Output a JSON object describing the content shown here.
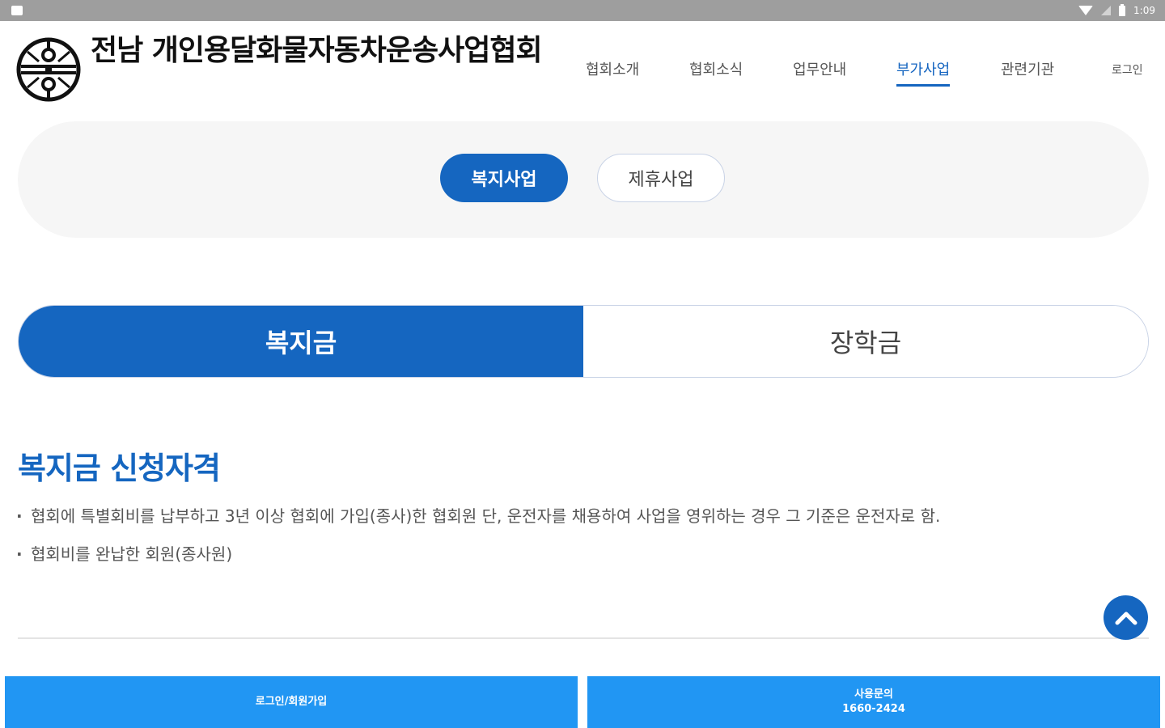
{
  "status_bar": {
    "time": "1:09",
    "icons": [
      "notification-icon",
      "wifi-icon",
      "signal-icon",
      "battery-icon"
    ]
  },
  "header": {
    "site_title": "전남 개인용달화물자동차운송사업협회",
    "logo_icon": "association-logo-icon",
    "nav": [
      {
        "label": "협회소개",
        "active": false
      },
      {
        "label": "협회소식",
        "active": false
      },
      {
        "label": "업무안내",
        "active": false
      },
      {
        "label": "부가사업",
        "active": true
      },
      {
        "label": "관련기관",
        "active": false
      }
    ],
    "login_label": "로그인"
  },
  "sub_tabs": {
    "items": [
      {
        "label": "복지사업",
        "active": true
      },
      {
        "label": "제휴사업",
        "active": false
      }
    ]
  },
  "segment_tabs": {
    "items": [
      {
        "label": "복지금",
        "active": true
      },
      {
        "label": "장학금",
        "active": false
      }
    ]
  },
  "content": {
    "title": "복지금 신청자격",
    "bullets": [
      "협회에 특별회비를 납부하고 3년 이상 협회에 가입(종사)한 협회원 단, 운전자를 채용하여 사업을 영위하는 경우 그 기준은 운전자로 함.",
      "협회비를 완납한 회원(종사원)"
    ]
  },
  "scroll_top_icon": "chevron-up-icon",
  "bottom_bar": {
    "left_label": "로그인/회원가입",
    "right_label": "사용문의",
    "right_phone": "1660-2424"
  },
  "colors": {
    "primary": "#1566c0",
    "bottom_bar": "#2196f3",
    "status_bar": "#9e9e9e"
  }
}
